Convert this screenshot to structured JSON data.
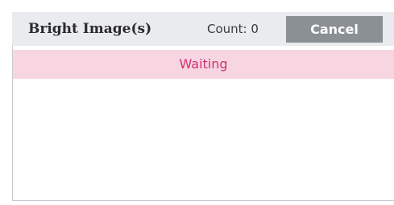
{
  "header": {
    "title": "Bright Image(s)",
    "count_label": "Count: 0",
    "cancel_label": "Cancel"
  },
  "list": {
    "status_text": "Waiting"
  },
  "colors": {
    "header_bg": "#e9ebee",
    "cancel_bg": "#8b9095",
    "status_bg": "#f7d6e2",
    "status_text": "#d0306f"
  }
}
